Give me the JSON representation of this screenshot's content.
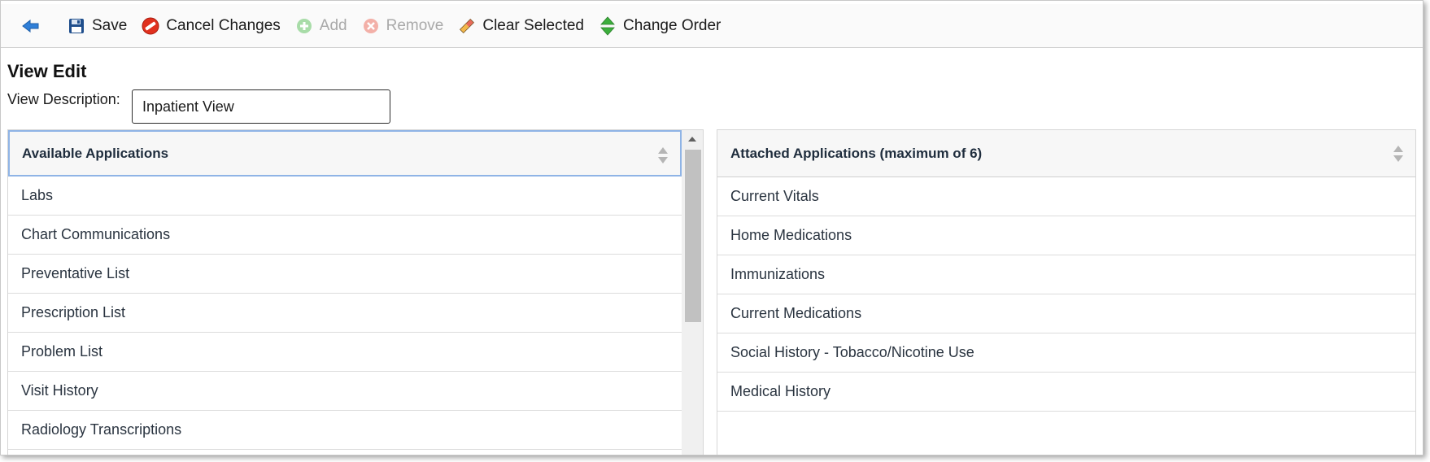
{
  "toolbar": {
    "back": {
      "icon": "back-arrow-icon"
    },
    "save": {
      "label": "Save",
      "icon": "floppy-disk-icon"
    },
    "cancel_changes": {
      "label": "Cancel Changes",
      "icon": "cancel-icon"
    },
    "add": {
      "label": "Add",
      "icon": "plus-circle-icon",
      "disabled": true
    },
    "remove": {
      "label": "Remove",
      "icon": "remove-circle-icon",
      "disabled": true
    },
    "clear_selected": {
      "label": "Clear Selected",
      "icon": "eraser-icon"
    },
    "change_order": {
      "label": "Change Order",
      "icon": "up-down-arrows-icon"
    }
  },
  "page": {
    "title": "View Edit",
    "description_label": "View Description:",
    "description_value": "Inpatient View"
  },
  "available": {
    "header": "Available Applications",
    "items": [
      "Labs",
      "Chart Communications",
      "Preventative List",
      "Prescription List",
      "Problem List",
      "Visit History",
      "Radiology Transcriptions"
    ]
  },
  "attached": {
    "header": "Attached Applications (maximum of 6)",
    "items": [
      "Current Vitals",
      "Home Medications",
      "Immunizations",
      "Current Medications",
      "Social History - Tobacco/Nicotine Use",
      "Medical History"
    ]
  },
  "colors": {
    "accent_border": "#8fb4e6",
    "back_arrow": "#2f7fd8",
    "cancel_red": "#e0301e",
    "change_order_green": "#3cae3c"
  }
}
